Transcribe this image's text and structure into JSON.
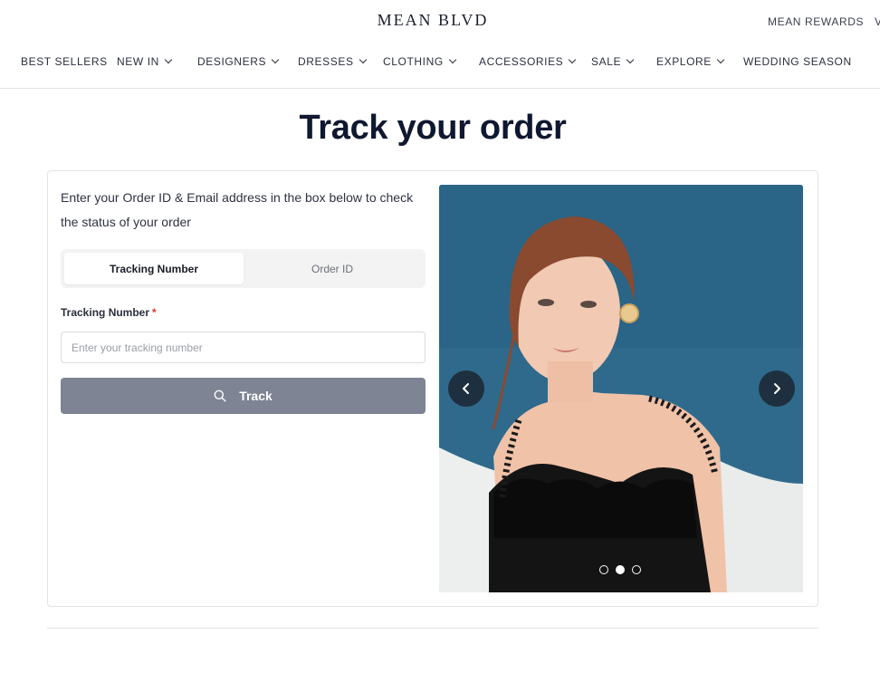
{
  "header": {
    "brand": "MEAN BLVD",
    "rewards": "MEAN REWARDS",
    "rewards_cut": "V"
  },
  "nav": {
    "items": [
      {
        "label": "BEST SELLERS",
        "dropdown": false
      },
      {
        "label": "NEW IN",
        "dropdown": true
      },
      {
        "label": "DESIGNERS",
        "dropdown": true
      },
      {
        "label": "DRESSES",
        "dropdown": true
      },
      {
        "label": "CLOTHING",
        "dropdown": true
      },
      {
        "label": "ACCESSORIES",
        "dropdown": true
      },
      {
        "label": "SALE",
        "dropdown": true
      },
      {
        "label": "EXPLORE",
        "dropdown": true
      },
      {
        "label": "WEDDING SEASON",
        "dropdown": false
      }
    ]
  },
  "main": {
    "title": "Track your order",
    "intro": "Enter your Order ID & Email address in the box below to check the status of your order",
    "tabs": [
      {
        "label": "Tracking Number",
        "active": true
      },
      {
        "label": "Order ID",
        "active": false
      }
    ],
    "field_label": "Tracking Number",
    "required_mark": "*",
    "input_placeholder": "Enter your tracking number",
    "input_value": "",
    "button_label": "Track"
  },
  "carousel": {
    "slide_count": 3,
    "active_slide": 2,
    "prev_icon": "chevron-left-icon",
    "next_icon": "chevron-right-icon"
  },
  "colors": {
    "button_bg": "#7e8494",
    "photo_backdrop": "#2f6a8c",
    "required": "#dd3333"
  }
}
